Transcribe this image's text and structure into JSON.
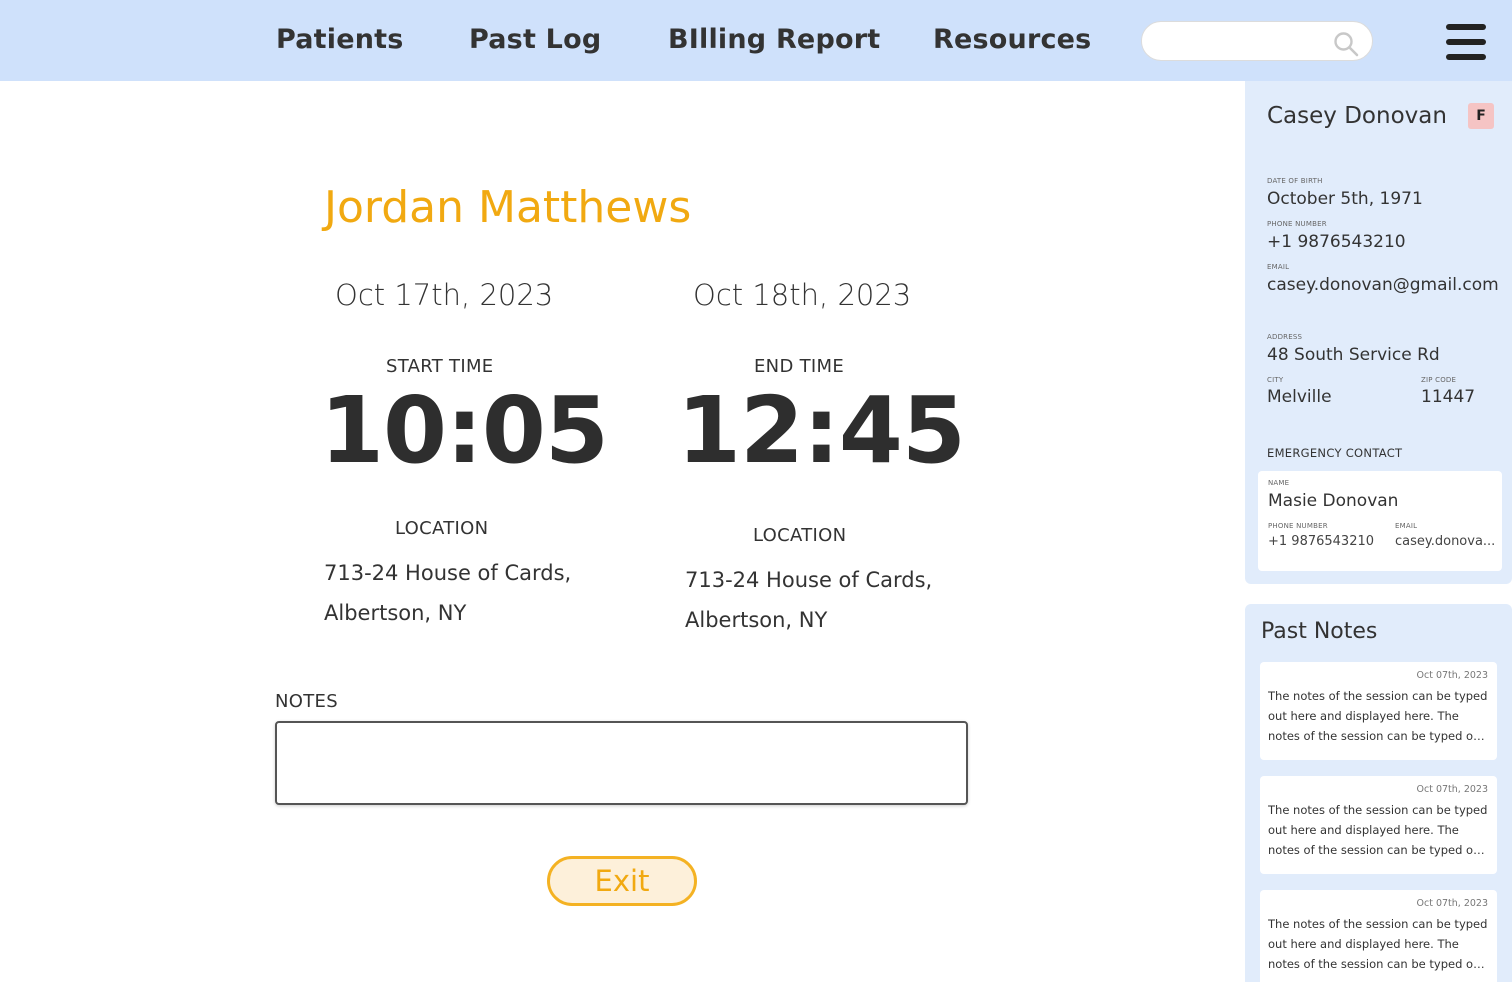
{
  "nav": {
    "items": [
      {
        "label": "Patients"
      },
      {
        "label": "Past Log"
      },
      {
        "label": "BIlling Report"
      },
      {
        "label": "Resources"
      }
    ],
    "search_value": "",
    "search_placeholder": ""
  },
  "session": {
    "patient_name": "Jordan Matthews",
    "start": {
      "date": "Oct 17th, 2023",
      "label": "START TIME",
      "time": "10:05",
      "location_label": "LOCATION",
      "location": "713-24 House of Cards, Albertson, NY"
    },
    "end": {
      "date": "Oct 18th, 2023",
      "label": "END TIME",
      "time": "12:45",
      "location_label": "LOCATION",
      "location": "713-24 House of Cards, Albertson, NY"
    },
    "notes_label": "NOTES",
    "notes_value": "",
    "exit_label": "Exit"
  },
  "patient_card": {
    "name": "Casey Donovan",
    "gender": "F",
    "dob_label": "DATE OF BIRTH",
    "dob": "October 5th, 1971",
    "phone_label": "PHONE NUMBER",
    "phone": "+1  9876543210",
    "email_label": "EMAIL",
    "email": "casey.donovan@gmail.com",
    "address_label": "ADDRESS",
    "address": "48 South Service Rd",
    "city_label": "CITY",
    "city": "Melville",
    "zip_label": "ZIP CODE",
    "zip": "11447",
    "emergency": {
      "section_label": "EMERGENCY CONTACT",
      "name_label": "NAME",
      "name": "Masie Donovan",
      "phone_label": "PHONE NUMBER",
      "phone": "+1  9876543210",
      "email_label": "EMAIL",
      "email": "casey.donova..."
    }
  },
  "past_notes": {
    "title": "Past Notes",
    "items": [
      {
        "date": "Oct 07th, 2023",
        "text": "The notes of the session can be typed out here and displayed here. The notes of the session can be typed out here a..."
      },
      {
        "date": "Oct 07th, 2023",
        "text": "The notes of the session can be typed out here and displayed here. The notes of the session can be typed out here a..."
      },
      {
        "date": "Oct 07th, 2023",
        "text": "The notes of the session can be typed out here and displayed here. The notes of the session can be typed out here a..."
      }
    ]
  },
  "colors": {
    "nav_bg": "#cfe1fb",
    "accent": "#f1a911",
    "panel_bg": "#e1ecfb",
    "badge_female": "#f5c4c4"
  },
  "icons": {
    "search": "search-icon",
    "menu": "hamburger-menu-icon"
  }
}
